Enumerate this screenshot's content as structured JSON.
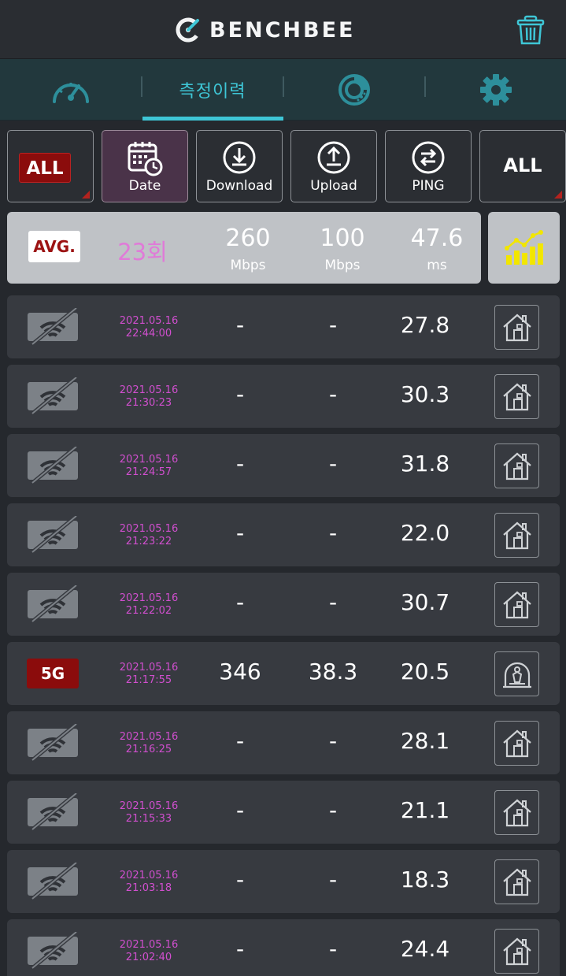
{
  "app": {
    "brand": "BENCHBEE"
  },
  "tabs": [
    {
      "icon": "speedometer-icon"
    },
    {
      "label": "측정이력"
    },
    {
      "icon": "pie-chart-icon"
    },
    {
      "icon": "gear-icon"
    }
  ],
  "filters": {
    "network": "ALL",
    "date": "Date",
    "download": "Download",
    "upload": "Upload",
    "ping": "PING",
    "place": "ALL"
  },
  "average": {
    "badge": "AVG.",
    "count": "23회",
    "download": "260",
    "download_unit": "Mbps",
    "upload": "100",
    "upload_unit": "Mbps",
    "ping": "47.6",
    "ping_unit": "ms"
  },
  "records": [
    {
      "network": "wifi-off",
      "date": "2021.05.16",
      "time": "22:44:00",
      "download": "-",
      "upload": "-",
      "ping": "27.8",
      "place": "home"
    },
    {
      "network": "wifi-off",
      "date": "2021.05.16",
      "time": "21:30:23",
      "download": "-",
      "upload": "-",
      "ping": "30.3",
      "place": "home"
    },
    {
      "network": "wifi-off",
      "date": "2021.05.16",
      "time": "21:24:57",
      "download": "-",
      "upload": "-",
      "ping": "31.8",
      "place": "home"
    },
    {
      "network": "wifi-off",
      "date": "2021.05.16",
      "time": "21:23:22",
      "download": "-",
      "upload": "-",
      "ping": "22.0",
      "place": "home"
    },
    {
      "network": "wifi-off",
      "date": "2021.05.16",
      "time": "21:22:02",
      "download": "-",
      "upload": "-",
      "ping": "30.7",
      "place": "home"
    },
    {
      "network": "5G",
      "date": "2021.05.16",
      "time": "21:17:55",
      "download": "346",
      "upload": "38.3",
      "ping": "20.5",
      "place": "other"
    },
    {
      "network": "wifi-off",
      "date": "2021.05.16",
      "time": "21:16:25",
      "download": "-",
      "upload": "-",
      "ping": "28.1",
      "place": "home"
    },
    {
      "network": "wifi-off",
      "date": "2021.05.16",
      "time": "21:15:33",
      "download": "-",
      "upload": "-",
      "ping": "21.1",
      "place": "home"
    },
    {
      "network": "wifi-off",
      "date": "2021.05.16",
      "time": "21:03:18",
      "download": "-",
      "upload": "-",
      "ping": "18.3",
      "place": "home"
    },
    {
      "network": "wifi-off",
      "date": "2021.05.16",
      "time": "21:02:40",
      "download": "-",
      "upload": "-",
      "ping": "24.4",
      "place": "home"
    }
  ],
  "colors": {
    "accent": "#3ec6d6",
    "timestamp": "#d14fcf",
    "badge_red": "#8b0c0c",
    "chart_yellow": "#f2e600"
  }
}
